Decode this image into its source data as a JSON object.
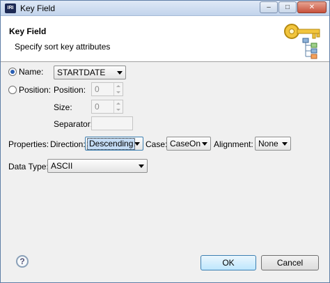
{
  "window": {
    "app_icon": "IRI",
    "title": "Key Field",
    "controls": {
      "minimize": "–",
      "maximize": "□",
      "close": "✕"
    }
  },
  "header": {
    "title": "Key Field",
    "subtitle": "Specify sort key attributes",
    "icon": "key-with-tree-icon"
  },
  "name_row": {
    "radio_label": "Name:",
    "selected": true,
    "combo_value": "STARTDATE"
  },
  "position_row": {
    "radio_label": "Position:",
    "selected": false,
    "position_label": "Position:",
    "position_value": "0",
    "size_label": "Size:",
    "size_value": "0",
    "separator_label": "Separator:",
    "separator_value": ""
  },
  "properties_row": {
    "label": "Properties:",
    "direction_label": "Direction:",
    "direction_value": "Descending",
    "case_label": "Case:",
    "case_value": "CaseOn",
    "alignment_label": "Alignment:",
    "alignment_value": "None"
  },
  "data_type_row": {
    "label": "Data Type:",
    "value": "ASCII"
  },
  "footer": {
    "help": "?",
    "ok_label": "OK",
    "cancel_label": "Cancel"
  },
  "colors": {
    "accent": "#3c7fb1",
    "titlebar": "#c2d4ec",
    "close_button": "#c7513b"
  }
}
